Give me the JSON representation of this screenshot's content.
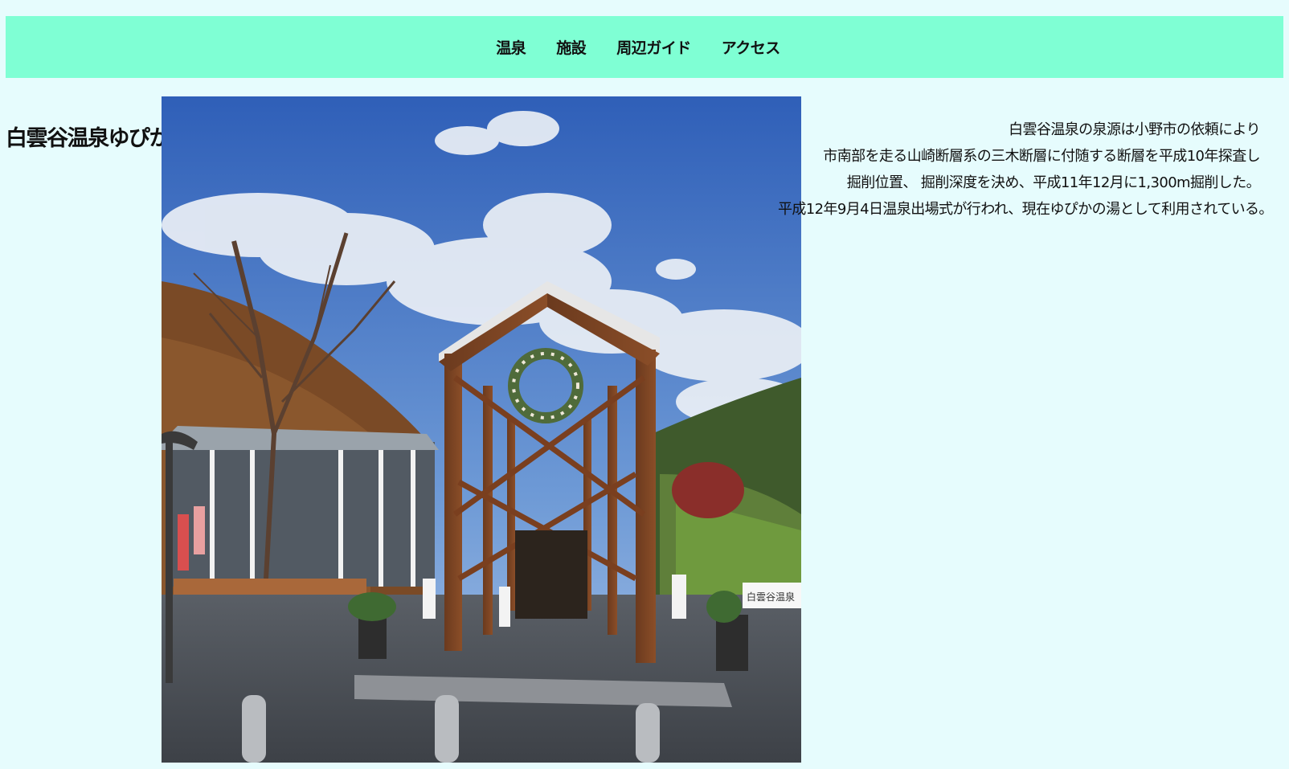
{
  "nav": {
    "items": [
      {
        "label": "温泉"
      },
      {
        "label": "施設"
      },
      {
        "label": "周辺ガイド"
      },
      {
        "label": "アクセス"
      }
    ]
  },
  "page_title": "白雲谷温泉ゆぴか",
  "description": {
    "lines": [
      "白雲谷温泉の泉源は小野市の依頼により",
      "市南部を走る山崎断層系の三木断層に付随する断層を平成10年探査し",
      "掘削位置、 掘削深度を決め、平成11年12月に1,300m掘削した。",
      "平成12年9月4日温泉出場式が行われ、現在ゆぴかの湯として利用されている。"
    ]
  },
  "photo": {
    "sign_text": "白雲谷温泉"
  },
  "colors": {
    "background": "#e6fcfd",
    "navbar": "#7fffd4"
  }
}
